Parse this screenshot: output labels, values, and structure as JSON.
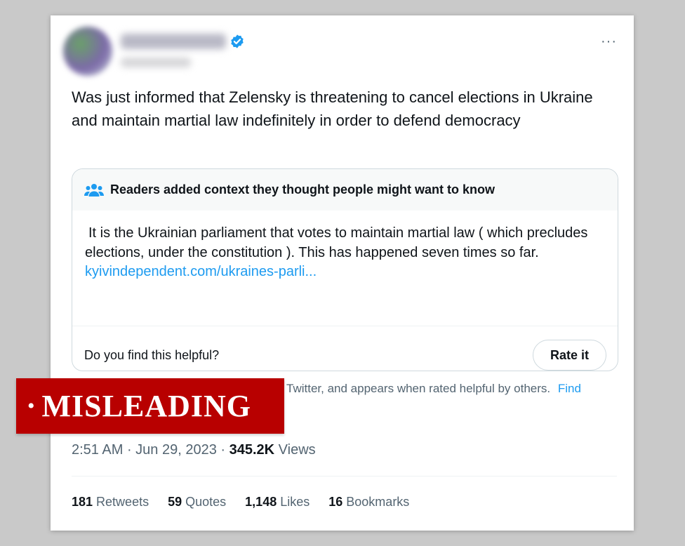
{
  "tweet": {
    "text": "Was just informed that Zelensky is threatening to cancel elections in Ukraine and maintain martial law indefinitely in order to defend democracy",
    "more_icon": "···"
  },
  "community_note": {
    "header": "Readers added context they thought people might want to know",
    "body": "It is the Ukrainian parliament that votes to maintain martial law ( which precludes elections, under the constitution ). This has happened seven times so far.",
    "link": "kyivindependent.com/ukraines-parli...",
    "helpful_question": "Do you find this helpful?",
    "rate_button": "Rate it"
  },
  "footnote": {
    "text": "Twitter, and appears when rated helpful by others.",
    "link": "Find"
  },
  "timestamp": {
    "time": "2:51 AM",
    "sep1": " · ",
    "date": "Jun 29, 2023",
    "sep2": " · ",
    "views_count": "345.2K",
    "views_label": " Views"
  },
  "stats": {
    "retweets_count": "181",
    "retweets_label": " Retweets",
    "quotes_count": "59",
    "quotes_label": " Quotes",
    "likes_count": "1,148",
    "likes_label": " Likes",
    "bookmarks_count": "16",
    "bookmarks_label": " Bookmarks"
  },
  "banner": {
    "bullet": "•",
    "label": "MISLEADING"
  },
  "colors": {
    "accent_blue": "#1d9bf0",
    "banner_red": "#b80000",
    "text_primary": "#0f1419",
    "text_secondary": "#536471"
  }
}
